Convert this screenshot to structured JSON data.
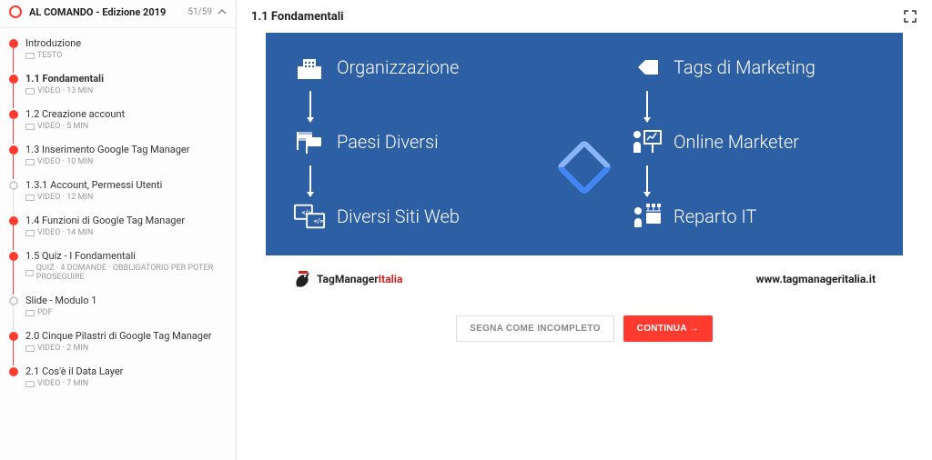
{
  "sidebar": {
    "title": "AL COMANDO - Edizione 2019",
    "count": "51/59",
    "items": [
      {
        "title": "Introduzione",
        "meta": "TESTO",
        "done": true,
        "active": false
      },
      {
        "title": "1.1 Fondamentali",
        "meta": "VIDEO · 13 MIN",
        "done": true,
        "active": true
      },
      {
        "title": "1.2 Creazione account",
        "meta": "VIDEO · 5 MIN",
        "done": true,
        "active": false
      },
      {
        "title": "1.3 Inserimento Google Tag Manager",
        "meta": "VIDEO · 10 MIN",
        "done": true,
        "active": false
      },
      {
        "title": "1.3.1 Account, Permessi Utenti",
        "meta": "VIDEO · 12 MIN",
        "done": false,
        "active": false
      },
      {
        "title": "1.4 Funzioni di Google Tag Manager",
        "meta": "VIDEO · 14 MIN",
        "done": true,
        "active": false
      },
      {
        "title": "1.5 Quiz - I Fondamentali",
        "meta": "QUIZ · 4 DOMANDE · OBBLIGATORIO PER POTER PROSEGUIRE",
        "done": true,
        "active": false,
        "quiz": true
      },
      {
        "title": "Slide - Modulo 1",
        "meta": "PDF",
        "done": false,
        "active": false
      },
      {
        "title": "2.0 Cinque Pilastri di Google Tag Manager",
        "meta": "VIDEO · 2 MIN",
        "done": true,
        "active": false
      },
      {
        "title": "2.1 Cos'è il Data Layer",
        "meta": "VIDEO · 7 MIN",
        "done": true,
        "active": false
      }
    ]
  },
  "main": {
    "title": "1.1 Fondamentali",
    "slide": {
      "left": [
        "Organizzazione",
        "Paesi Diversi",
        "Diversi Siti Web"
      ],
      "right": [
        "Tags di Marketing",
        "Online Marketer",
        "Reparto IT"
      ]
    },
    "brand_tm": "TagManager",
    "brand_it": "Italia",
    "url": "www.tagmanageritalia.it",
    "btn_secondary": "SEGNA COME INCOMPLETO",
    "btn_primary": "CONTINUA  →"
  }
}
